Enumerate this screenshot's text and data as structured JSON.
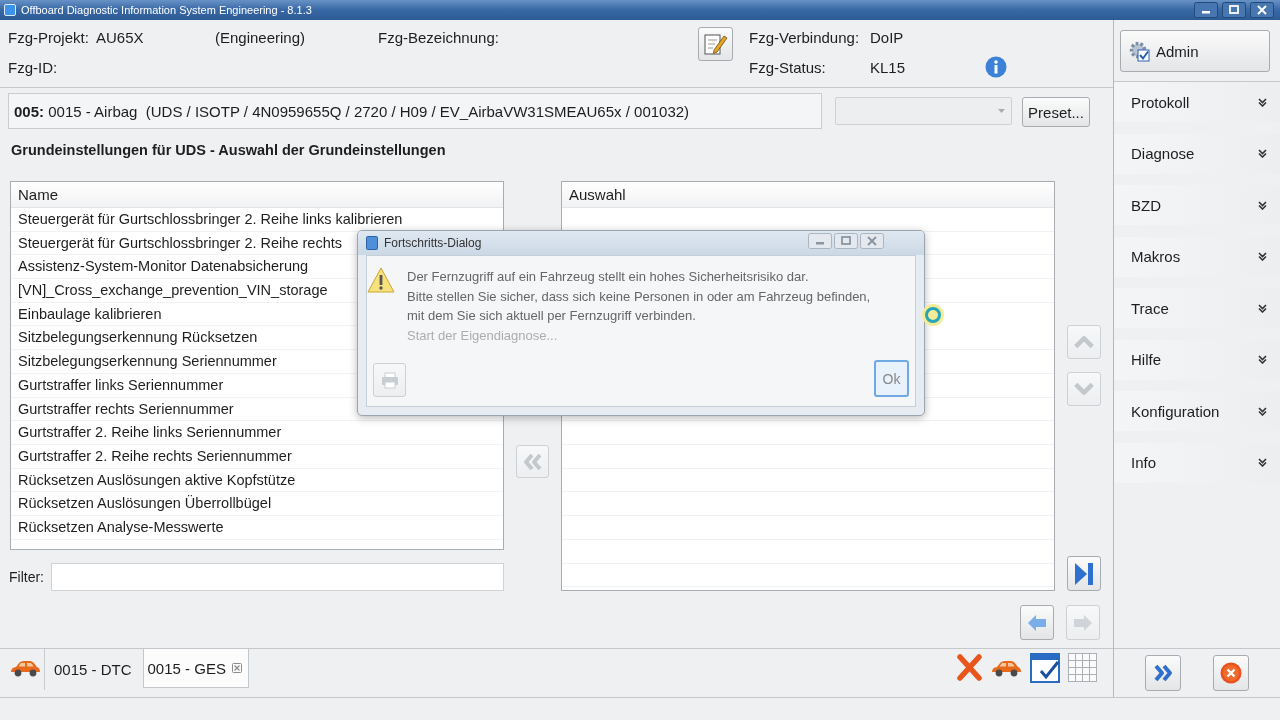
{
  "window": {
    "title": "Offboard Diagnostic Information System Engineering - 8.1.3"
  },
  "vehicle": {
    "project_label": "Fzg-Projekt:",
    "project": "AU65X",
    "mode": "(Engineering)",
    "designation_label": "Fzg-Bezeichnung:",
    "id_label": "Fzg-ID:",
    "connection_label": "Fzg-Verbindung:",
    "connection": "DoIP",
    "status_label": "Fzg-Status:",
    "status": "KL15"
  },
  "control_unit": {
    "path": "**005:** 0015 - Airbag  (UDS / ISOTP / 4N0959655Q / 2720 / H09 / EV_AirbaVW31SMEAU65x / 001032)",
    "preset_dropdown": {
      "disabled": true
    },
    "preset_button": "Preset..."
  },
  "heading": "Grundeinstellungen für UDS - Auswahl der Grundeinstellungen",
  "available_list": {
    "column": "Name",
    "rows": [
      "Steuergerät für Gurtschlossbringer 2. Reihe links kalibrieren",
      "Steuergerät für Gurtschlossbringer 2. Reihe rechts",
      "Assistenz-System-Monitor Datenabsicherung",
      "[VN]_Cross_exchange_prevention_VIN_storage",
      "Einbaulage kalibrieren",
      "Sitzbelegungserkennung Rücksetzen",
      "Sitzbelegungserkennung Seriennummer",
      "Gurtstraffer links Seriennummer",
      "Gurtstraffer rechts Seriennummer",
      "Gurtstraffer 2. Reihe links Seriennummer",
      "Gurtstraffer 2. Reihe rechts Seriennummer",
      "Rücksetzen Auslösungen aktive Kopfstütze",
      "Rücksetzen Auslösungen Überrollbügel",
      "Rücksetzen Analyse-Messwerte"
    ]
  },
  "filter": {
    "label": "Filter:"
  },
  "selection_list": {
    "column": "Auswahl"
  },
  "list_buttons": {
    "remove": {
      "disabled": true
    },
    "move": [
      {
        "kind": "up",
        "disabled": true
      },
      {
        "kind": "down",
        "disabled": true
      }
    ],
    "last": {
      "disabled": false
    }
  },
  "navigation": [
    {
      "kind": "back",
      "disabled": false
    },
    {
      "kind": "forward",
      "disabled": true
    }
  ],
  "tabs": [
    {
      "label": "0015 - DTC",
      "selected": false,
      "closable": false
    },
    {
      "label": "0015 - GES",
      "selected": true,
      "closable": true
    }
  ],
  "toolbar": [
    {
      "kind": "cancel",
      "disabled": false
    },
    {
      "kind": "vehicle",
      "disabled": false
    },
    {
      "kind": "checklist",
      "disabled": false
    },
    {
      "kind": "table",
      "disabled": true
    }
  ],
  "sidebar": {
    "admin_button": "Admin",
    "items": [
      {
        "label": "Protokoll",
        "expanded": false
      },
      {
        "label": "Diagnose",
        "expanded": false
      },
      {
        "label": "BZD",
        "expanded": false
      },
      {
        "label": "Makros",
        "expanded": false
      },
      {
        "label": "Trace",
        "expanded": false
      },
      {
        "label": "Hilfe",
        "expanded": false
      },
      {
        "label": "Konfiguration",
        "expanded": false
      },
      {
        "label": "Info",
        "expanded": false
      }
    ]
  },
  "sidebar_buttons": [
    {
      "kind": "next"
    },
    {
      "kind": "exit"
    }
  ],
  "dialog": {
    "title": "Fortschritts-Dialog",
    "lines": [
      "Der Fernzugriff auf ein Fahrzeug stellt ein hohes Sicherheitsrisiko dar.",
      "Bitte stellen Sie sicher, dass sich keine Personen in oder am Fahrzeug befinden,",
      "mit dem Sie sich aktuell per Fernzugriff verbinden."
    ],
    "status": "Start der Eigendiagnose...",
    "side_button": {
      "disabled": true
    },
    "ok_button": "Ok"
  }
}
